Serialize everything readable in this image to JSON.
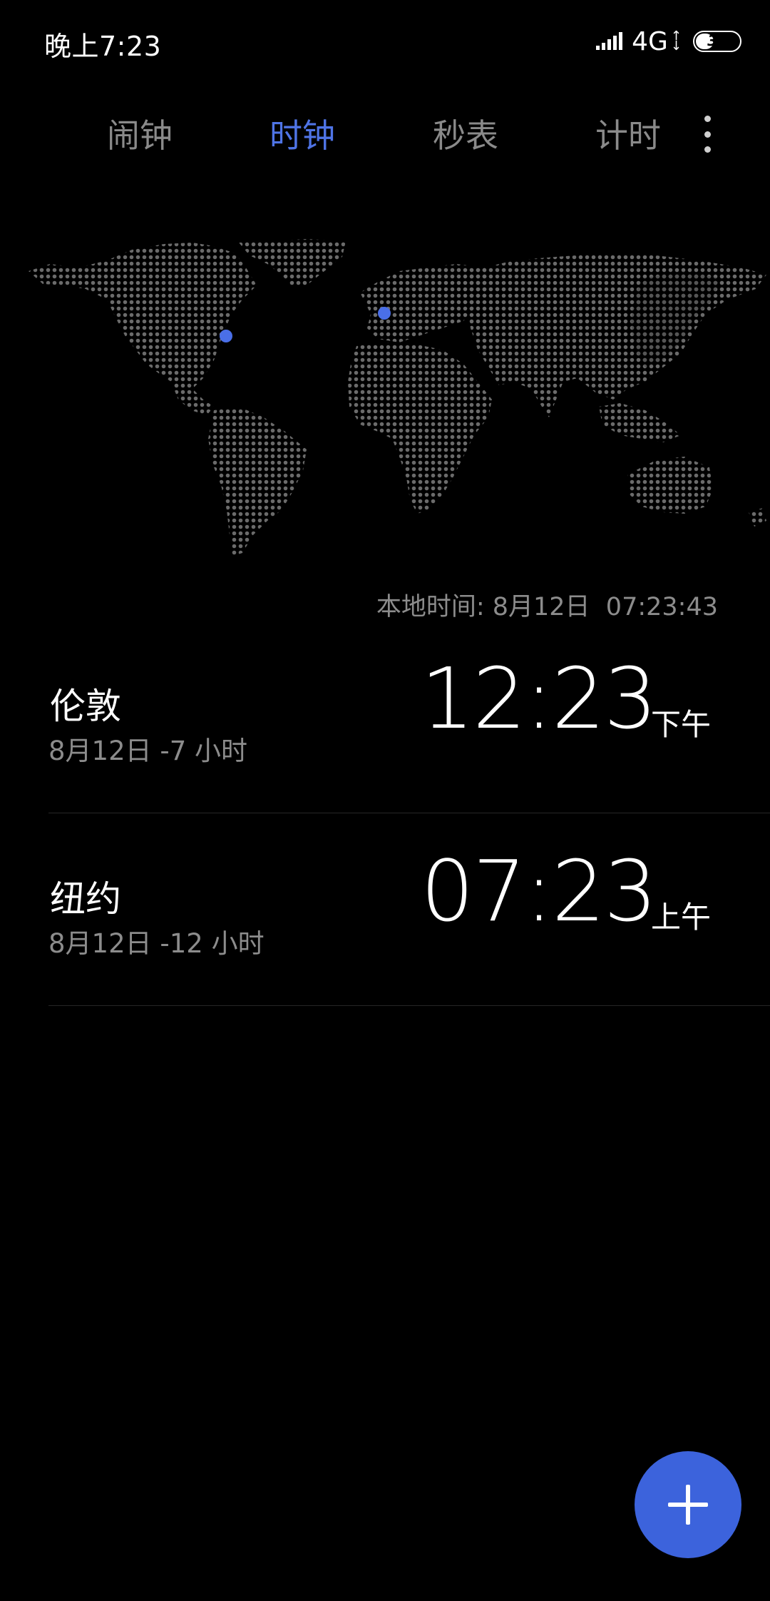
{
  "status_bar": {
    "time": "晚上7:23",
    "network": "4G",
    "battery_level": "39",
    "battery_fraction": 0.39
  },
  "tabs": [
    {
      "label": "闹钟",
      "active": false
    },
    {
      "label": "时钟",
      "active": true
    },
    {
      "label": "秒表",
      "active": false
    },
    {
      "label": "计时",
      "active": false
    }
  ],
  "more_icon": "more-vertical-icon",
  "colors": {
    "accent": "#4f74e6",
    "fab": "#3c63dc",
    "map_dot": "#6b6b6b",
    "marker": "#4a6fe8",
    "background": "#000000"
  },
  "local_time": "本地时间: 8月12日  07:23:43",
  "cities": [
    {
      "name": "伦敦",
      "meta": "8月12日 -7 小时",
      "time": "12:23",
      "period": "下午"
    },
    {
      "name": "纽约",
      "meta": "8月12日 -12 小时",
      "time": "07:23",
      "period": "上午"
    }
  ],
  "fab": {
    "icon": "plus-icon"
  }
}
